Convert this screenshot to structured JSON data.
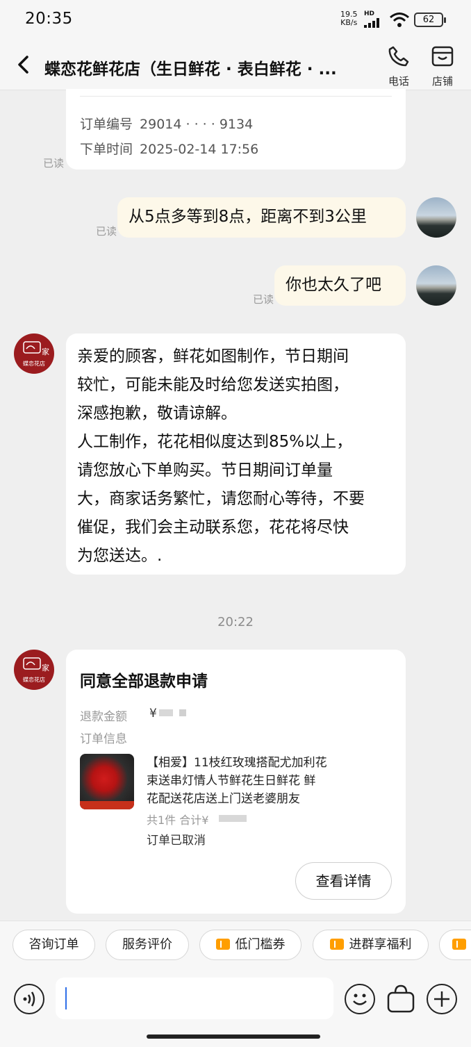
{
  "status_bar": {
    "time": "20:35",
    "net_speed_value": "19.5",
    "net_speed_unit": "KB/s",
    "network": "HD",
    "battery": "62"
  },
  "header": {
    "title": "蝶恋花鲜花店（生日鲜花 · 表白鲜花 · ...",
    "actions": [
      {
        "label": "电话",
        "icon": "phone-icon"
      },
      {
        "label": "店铺",
        "icon": "store-icon"
      }
    ]
  },
  "order_card": {
    "order_no_label": "订单编号",
    "order_no_value": "29014 · · · · 9134",
    "order_time_label": "下单时间",
    "order_time_value": "2025-02-14 17:56"
  },
  "messages": [
    {
      "from": "user",
      "text": "从5点多等到8点，距离不到3公里",
      "status": "已读"
    },
    {
      "from": "user",
      "text": "你也太久了吧",
      "status": "已读"
    },
    {
      "from": "shop",
      "lines": [
        "亲爱的顾客，鲜花如图制作，节日期间",
        "较忙，可能未能及时给您发送实拍图，",
        "深感抱歉，敬请谅解。",
        "人工制作，花花相似度达到85%以上，",
        "请您放心下单购买。节日期间订单量",
        "大，商家话务繁忙，请您耐心等待，不要",
        "催促，我们会主动联系您，花花将尽快",
        "为您送达。."
      ]
    }
  ],
  "first_read_status": "已读",
  "timestamp": "20:22",
  "shop_avatar_text": "蝶恋花店",
  "refund_card": {
    "title": "同意全部退款申请",
    "amount_label": "退款金额",
    "amount_value": "¥",
    "order_info_label": "订单信息",
    "product_lines": [
      "【相爱】11枝红玫瑰搭配尤加利花",
      "束送串灯情人节鲜花生日鲜花 鲜",
      "花配送花店送上门送老婆朋友"
    ],
    "count_text": "共1件 合计¥",
    "status_text": "订单已取消",
    "detail_button": "查看详情"
  },
  "quick_replies": [
    {
      "label": "咨询订单",
      "ticket": false
    },
    {
      "label": "服务评价",
      "ticket": false
    },
    {
      "label": "低门槛券",
      "ticket": true
    },
    {
      "label": "进群享福利",
      "ticket": true
    }
  ],
  "input": {
    "value": "",
    "placeholder": ""
  },
  "colors": {
    "accent": "#2f6fe8",
    "ticket": "#ff9e00",
    "shop_red": "#9b1c1f",
    "my_bubble": "#fdf8e9"
  }
}
